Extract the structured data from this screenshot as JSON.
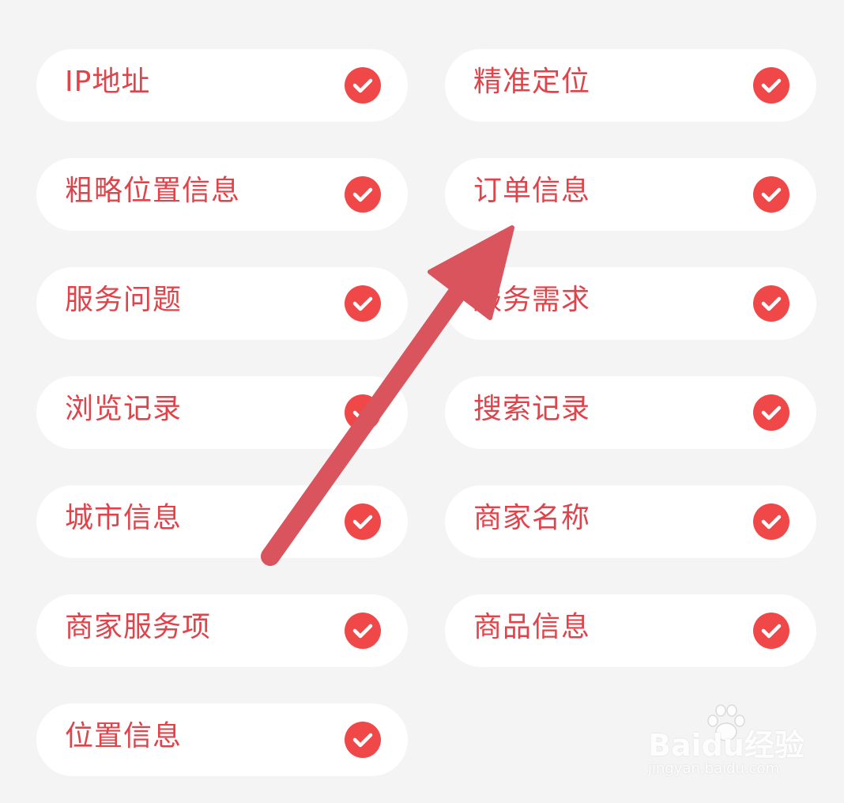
{
  "items": [
    {
      "label": "IP地址",
      "checked": true
    },
    {
      "label": "精准定位",
      "checked": true
    },
    {
      "label": "粗略位置信息",
      "checked": true
    },
    {
      "label": "订单信息",
      "checked": true
    },
    {
      "label": "服务问题",
      "checked": true
    },
    {
      "label": "服务需求",
      "checked": true
    },
    {
      "label": "浏览记录",
      "checked": true
    },
    {
      "label": "搜索记录",
      "checked": true
    },
    {
      "label": "城市信息",
      "checked": true
    },
    {
      "label": "商家名称",
      "checked": true
    },
    {
      "label": "商家服务项",
      "checked": true
    },
    {
      "label": "商品信息",
      "checked": true
    },
    {
      "label": "位置信息",
      "checked": true
    }
  ],
  "colors": {
    "accent": "#e0434a",
    "check": "#f04848",
    "arrow": "#d9545c",
    "background": "#f4f4f4",
    "chip": "#ffffff"
  },
  "watermark": {
    "logo": "Baidu经验",
    "url": "jingyan.baidu.com"
  }
}
